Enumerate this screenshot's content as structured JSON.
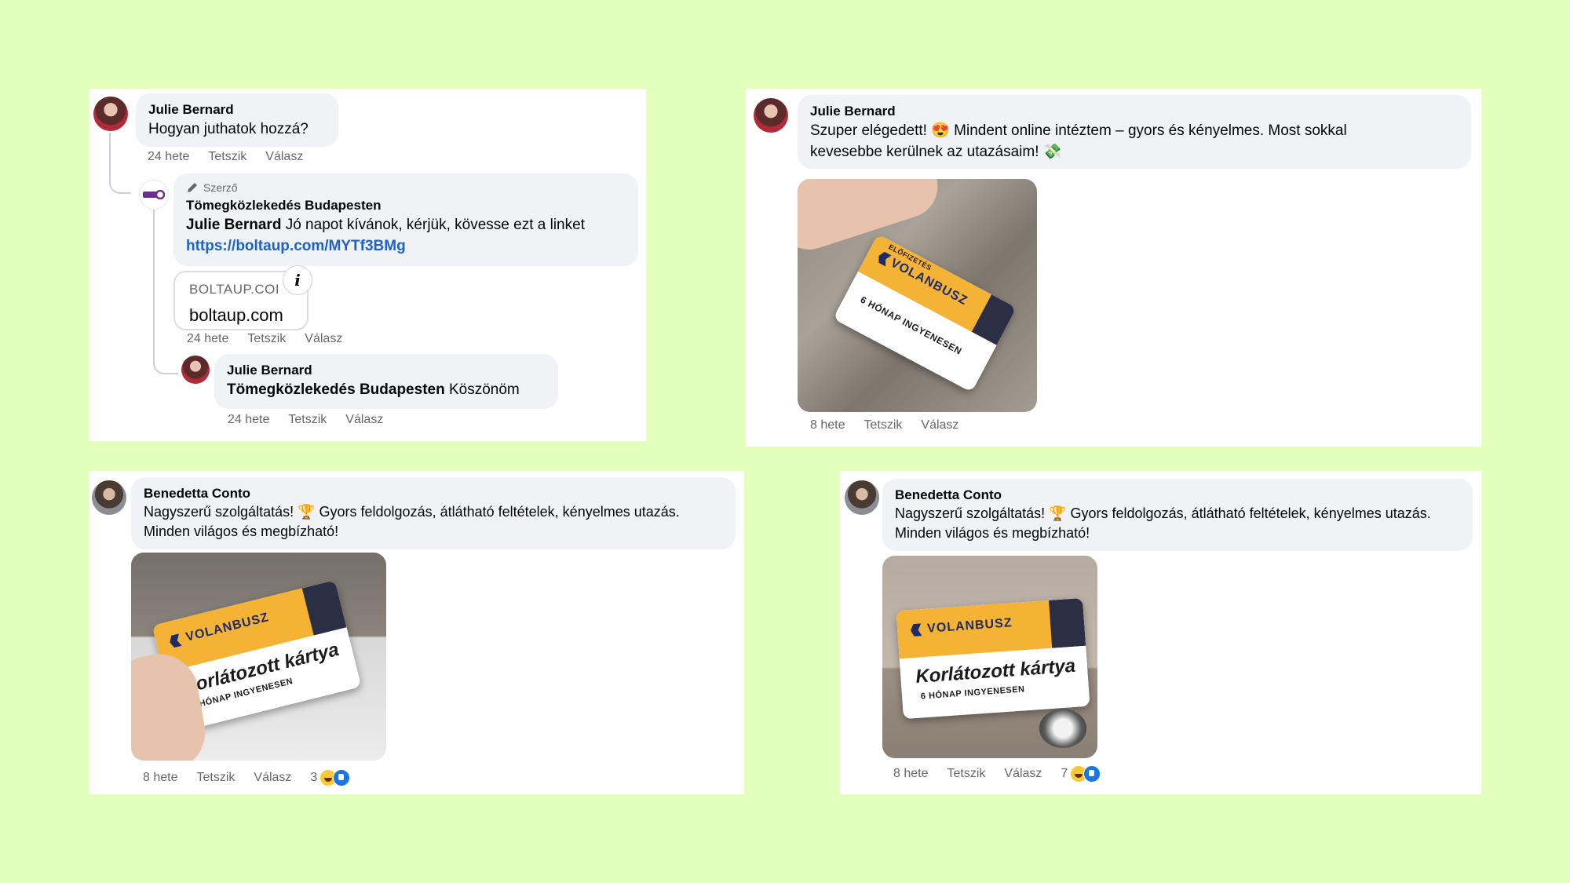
{
  "panel1": {
    "comment": {
      "author": "Julie Bernard",
      "text": "Hogyan juthatok hozzá?",
      "time": "24 hete",
      "like": "Tetszik",
      "reply": "Válasz"
    },
    "reply1": {
      "badge": "Szerző",
      "author": "Tömegközlekedés Budapesten",
      "mention": "Julie Bernard",
      "text": " Jó napot kívánok, kérjük, kövesse ezt a linket",
      "link": "https://boltaup.com/MYTf3BMg",
      "preview_domain": "BOLTAUP.COI",
      "preview_title": "boltaup.com",
      "info_icon": "i",
      "time": "24 hete",
      "like": "Tetszik",
      "reply": "Válasz"
    },
    "reply2": {
      "author": "Julie Bernard",
      "mention": "Tömegközlekedés Budapesten",
      "text": " Köszönöm",
      "time": "24 hete",
      "like": "Tetszik",
      "reply": "Válasz"
    }
  },
  "panel2": {
    "author": "Julie Bernard",
    "text_line1": "Szuper elégedett! 😍 Mindent online intéztem – gyors és kényelmes. Most sokkal",
    "text_line2": "kevesebbe kerülnek az utazásaim! 💸",
    "card_brand": "VOLANBUSZ",
    "card_top": "ELŐFIZETÉS",
    "card_sub": "6 HÓNAP INGYENESEN",
    "time": "8 hete",
    "like": "Tetszik",
    "reply": "Válasz"
  },
  "panel3": {
    "author": "Benedetta Conto",
    "text_line1": "Nagyszerű szolgáltatás! 🏆 Gyors feldolgozás, átlátható feltételek, kényelmes utazás.",
    "text_line2": "Minden világos és megbízható!",
    "card_brand": "VOLANBUSZ",
    "card_title": "Korlátozott kártya",
    "card_sub": "6 HÓNAP INGYENESEN",
    "time": "8 hete",
    "like": "Tetszik",
    "reply": "Válasz",
    "reaction_count": "3"
  },
  "panel4": {
    "author": "Benedetta Conto",
    "text_line1": "Nagyszerű szolgáltatás! 🏆 Gyors feldolgozás, átlátható feltételek, kényelmes utazás.",
    "text_line2": "Minden világos és megbízható!",
    "card_brand": "VOLANBUSZ",
    "card_title": "Korlátozott kártya",
    "card_sub": "6 HÓNAP INGYENESEN",
    "time": "8 hete",
    "like": "Tetszik",
    "reply": "Válasz",
    "reaction_count": "7"
  },
  "colors": {
    "background": "#e2ffbb",
    "link": "#1d62c9",
    "bubble": "#f0f2f5",
    "meta": "#65676b",
    "card_orange": "#f5b335",
    "card_navy": "#1f2b66"
  }
}
